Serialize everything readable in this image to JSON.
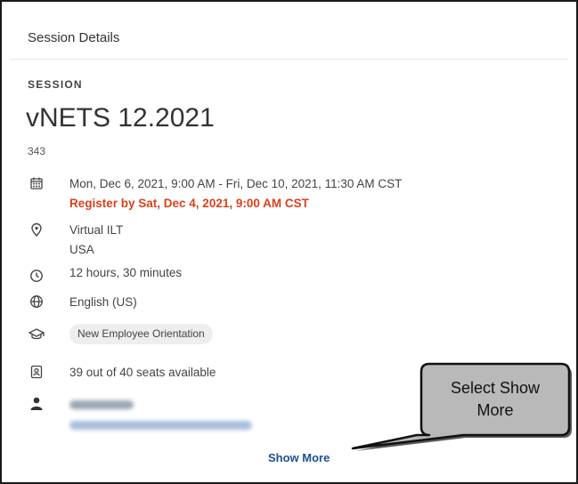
{
  "panel": {
    "header": "Session Details"
  },
  "session": {
    "eyebrow": "SESSION",
    "title": "vNETS 12.2021",
    "id": "343",
    "datetime": "Mon, Dec 6, 2021, 9:00 AM - Fri, Dec 10, 2021, 11:30 AM CST",
    "register_by": "Register by Sat, Dec 4, 2021, 9:00 AM CST",
    "location_line1": "Virtual ILT",
    "location_line2": "USA",
    "duration": "12 hours, 30 minutes",
    "language": "English (US)",
    "tag": "New Employee Orientation",
    "seats": "39 out of 40 seats available"
  },
  "icons": {
    "calendar": "calendar-icon",
    "location": "location-pin-icon",
    "duration": "clock-icon",
    "language": "globe-icon",
    "tag": "graduation-cap-icon",
    "seats": "seat-badge-icon",
    "instructor": "person-icon"
  },
  "instructor": {
    "blurred": true
  },
  "actions": {
    "show_more": "Show More"
  },
  "callout": {
    "line1": "Select Show",
    "line2": "More"
  },
  "colors": {
    "register": "#d9421b",
    "link": "#1d4f91",
    "callout_fill": "#b9b9b9"
  }
}
